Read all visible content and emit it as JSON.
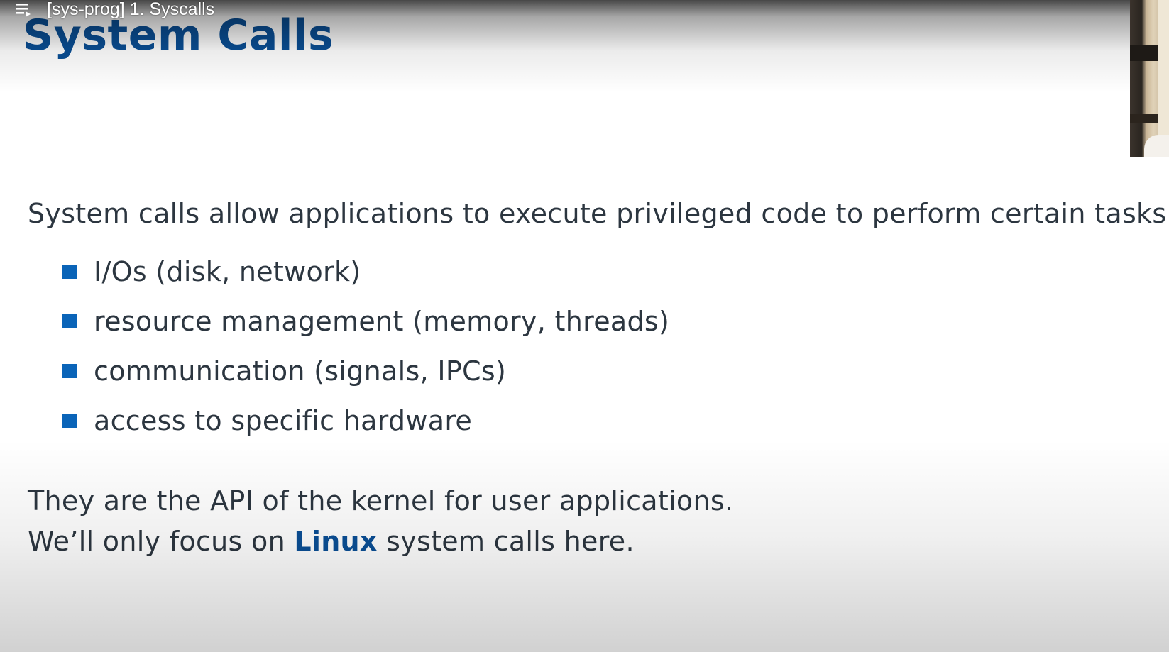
{
  "player": {
    "video_title": "[sys-prog] 1. Syscalls",
    "playlist_icon": "playlist-icon"
  },
  "slide": {
    "title": "System Calls",
    "intro": "System calls allow applications to execute privileged code to perform certain tasks:",
    "bullets": [
      "I/Os (disk, network)",
      "resource management (memory, threads)",
      "communication (signals, IPCs)",
      "access to specific hardware"
    ],
    "closing": {
      "line1": "They are the API of the kernel for user applications.",
      "line2_before": "We’ll only focus on ",
      "line2_emph": "Linux",
      "line2_after": " system calls here."
    }
  },
  "colors": {
    "title": "#0a4f96",
    "bullet_marker": "#0a64b8",
    "body_text": "#2c3640",
    "emphasis": "#0a4f96"
  }
}
